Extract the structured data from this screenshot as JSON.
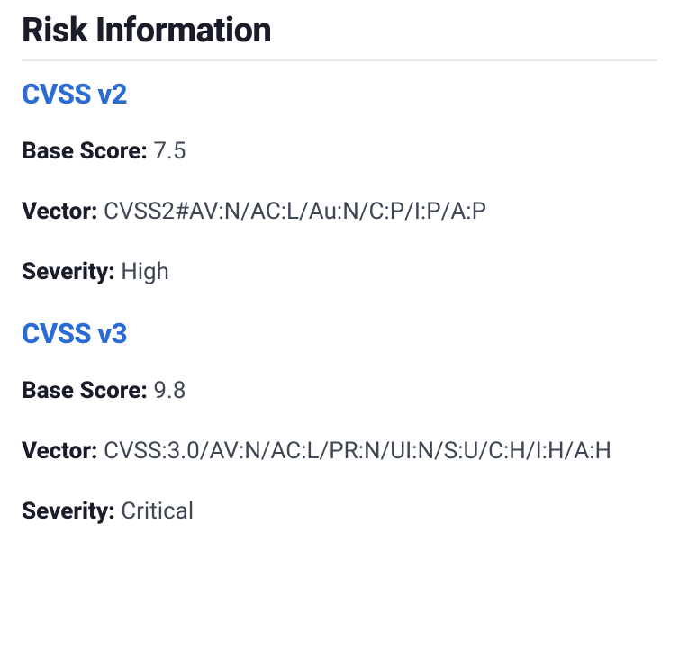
{
  "section": {
    "title": "Risk Information"
  },
  "cvss_v2": {
    "heading": "CVSS v2",
    "base_score": {
      "label": "Base Score:",
      "value": "7.5"
    },
    "vector": {
      "label": "Vector:",
      "value": "CVSS2#AV:N/AC:L/Au:N/C:P/I:P/A:P"
    },
    "severity": {
      "label": "Severity:",
      "value": "High"
    }
  },
  "cvss_v3": {
    "heading": "CVSS v3",
    "base_score": {
      "label": "Base Score:",
      "value": "9.8"
    },
    "vector": {
      "label": "Vector:",
      "value": "CVSS:3.0/AV:N/AC:L/PR:N/UI:N/S:U/C:H/I:H/A:H"
    },
    "severity": {
      "label": "Severity:",
      "value": "Critical"
    }
  }
}
